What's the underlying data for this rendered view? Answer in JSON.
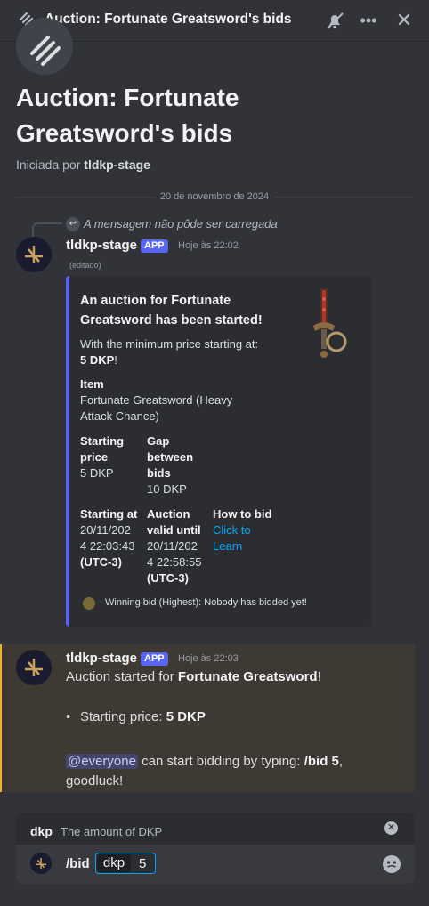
{
  "window": {
    "title": "Auction: Fortunate Greatsword's bids"
  },
  "toolbar": {
    "mute_icon": "bell-slash-icon",
    "more_icon": "more-icon",
    "close_icon": "close-icon"
  },
  "header": {
    "title_line1": "Auction: Fortunate",
    "title_line2": "Greatsword's bids",
    "started_by_prefix": "Iniciada por",
    "started_by_user": "tldkp-stage"
  },
  "date_divider": "20 de novembro de 2024",
  "reply": {
    "text": "A mensagem não pôde ser carregada"
  },
  "message1": {
    "author": "tldkp-stage",
    "badge": "APP",
    "timestamp": "Hoje às 22:02",
    "edited": "(editado)",
    "embed": {
      "color": "#5865f2",
      "title_l1": "An auction for Fortunate",
      "title_l2": "Greatsword has been started!",
      "desc_l1": "With the minimum price starting at:",
      "desc_price": "5 DKP",
      "desc_suffix": "!",
      "item_label": "Item",
      "item_l1": "Fortunate Greatsword (Heavy",
      "item_l2": "Attack Chance)",
      "starting_price_label_l1": "Starting",
      "starting_price_label_l2": "price",
      "starting_price_value": "5 DKP",
      "gap_label_l1": "Gap",
      "gap_label_l2": "between",
      "gap_label_l3": "bids",
      "gap_value": "10 DKP",
      "starting_at_label": "Starting at",
      "starting_at_l1": "20/11/202",
      "starting_at_l2": "4 22:03:43",
      "starting_at_tz": "(UTC-3)",
      "valid_label_l1": "Auction",
      "valid_label_l2": "valid until",
      "valid_l1": "20/11/202",
      "valid_l2": "4 22:58:55",
      "valid_tz": "(UTC-3)",
      "howto_label": "How to bid",
      "howto_link_l1": "Click to",
      "howto_link_l2": "Learn",
      "footer": "Winning bid (Highest): Nobody has bidded yet!"
    }
  },
  "message2": {
    "author": "tldkp-stage",
    "badge": "APP",
    "timestamp": "Hoje às 22:03",
    "line1_prefix": "Auction started for ",
    "line1_item": "Fortunate Greatsword",
    "line1_suffix": "!",
    "bullet_label": "Starting price: ",
    "bullet_value": "5 DKP",
    "mention": "@everyone",
    "line3_mid": " can start bidding by typing: ",
    "command": "/bid 5",
    "line3_end": ",",
    "line4": "goodluck!"
  },
  "composer": {
    "hint_name": "dkp",
    "hint_desc": "The amount of DKP",
    "command": "/bid",
    "option_name": "dkp",
    "option_value": "5"
  }
}
